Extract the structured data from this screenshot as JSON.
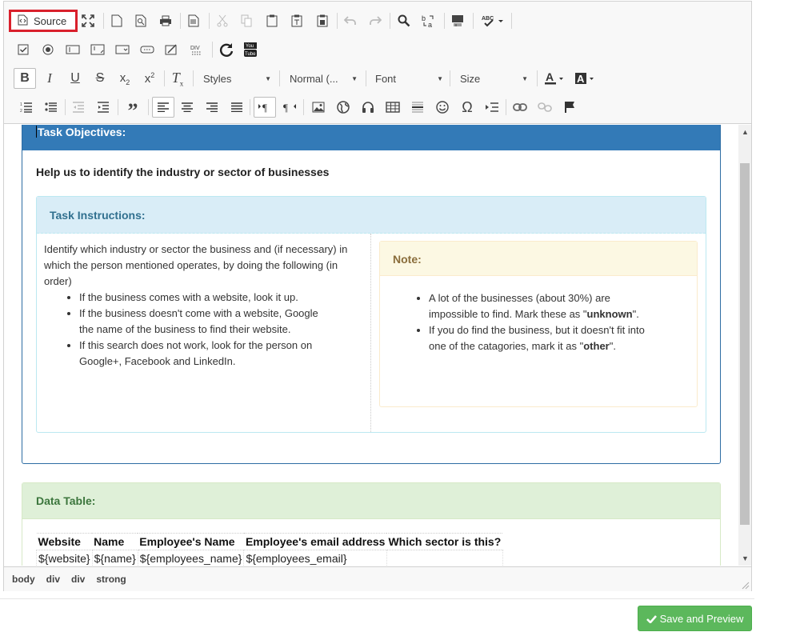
{
  "toolbar": {
    "source_label": "Source",
    "styles_combo": "Styles",
    "format_combo": "Normal (...",
    "font_combo": "Font",
    "size_combo": "Size"
  },
  "content": {
    "objectives_header": "Task Objectives:",
    "intro": "Help us to identify the industry or sector of businesses",
    "instructions_header": "Task Instructions:",
    "instructions_text": "Identify which industry or sector the business and (if necessary) in which the person mentioned operates, by doing the following (in order)",
    "instructions_items": [
      "If the business comes with a website, look it up.",
      "If the business doesn't come with a website, Google the name of the business to find their website.",
      "If this search does not work, look for the person on Google+, Facebook and LinkedIn."
    ],
    "note_header": "Note:",
    "note_item1_text": "A lot of the businesses (about 30%) are impossible to find. Mark these as ",
    "note_item1_q1": "\"",
    "note_item1_strong": "unknown",
    "note_item1_q2": "\".",
    "note_item2_text": "If you do find the business, but it doesn't fit into one of the catagories, mark it as ",
    "note_item2_q1": "\"",
    "note_item2_strong": "other",
    "note_item2_q2": "\".",
    "data_header": "Data Table:",
    "table_headers": [
      "Website",
      "Name",
      "Employee's Name",
      "Employee's email address",
      "Which sector is this?"
    ],
    "table_row": [
      "${website}",
      "${name}",
      "${employees_name}",
      "${employees_email}",
      ""
    ]
  },
  "statusbar": {
    "path": [
      "body",
      "div",
      "div",
      "strong"
    ]
  },
  "footer": {
    "save_label": "Save and Preview"
  },
  "colors": {
    "primary": "#337ab7",
    "success": "#5cb85c",
    "highlight_border": "#d9202c"
  }
}
